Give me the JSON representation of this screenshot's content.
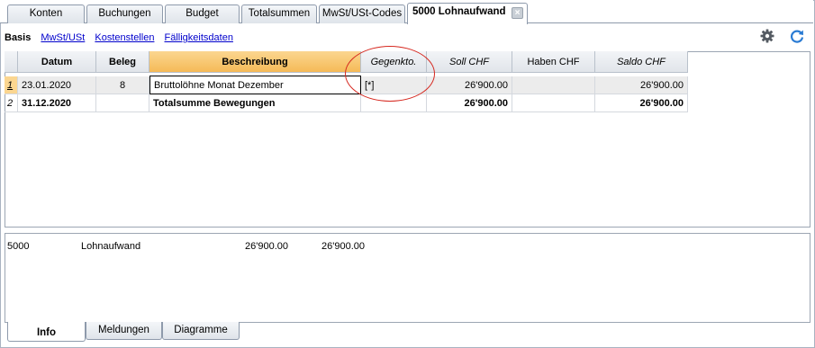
{
  "tabs": [
    {
      "label": "Konten"
    },
    {
      "label": "Buchungen"
    },
    {
      "label": "Budget"
    },
    {
      "label": "Totalsummen"
    },
    {
      "label": "MwSt/USt-Codes"
    },
    {
      "label": "5000 Lohnaufwand",
      "active": true
    }
  ],
  "subnav": {
    "current": "Basis",
    "links": [
      "MwSt/USt",
      "Kostenstellen",
      "Fälligkeitsdaten"
    ]
  },
  "toolbar": {
    "settings_icon": "gear-icon",
    "refresh_icon": "refresh-icon"
  },
  "table": {
    "columns": [
      "Datum",
      "Beleg",
      "Beschreibung",
      "Gegenkto.",
      "Soll CHF",
      "Haben CHF",
      "Saldo CHF"
    ],
    "rows": [
      {
        "num": "1",
        "datum": "23.01.2020",
        "beleg": "8",
        "beschreibung": "Bruttolöhne Monat Dezember",
        "gegenkto": "[*]",
        "soll": "26'900.00",
        "haben": "",
        "saldo": "26'900.00"
      },
      {
        "num": "2",
        "datum": "31.12.2020",
        "beleg": "",
        "beschreibung": "Totalsumme Bewegungen",
        "gegenkto": "",
        "soll": "26'900.00",
        "haben": "",
        "saldo": "26'900.00"
      }
    ]
  },
  "info": {
    "account": "5000",
    "name": "Lohnaufwand",
    "value1": "26'900.00",
    "value2": "26'900.00"
  },
  "bottom_tabs": [
    {
      "label": "Info",
      "active": true
    },
    {
      "label": "Meldungen"
    },
    {
      "label": "Diagramme"
    }
  ],
  "colors": {
    "selected_header": "#f5ba57",
    "highlight_ellipse": "#d6271e",
    "link": "#0000cc"
  }
}
